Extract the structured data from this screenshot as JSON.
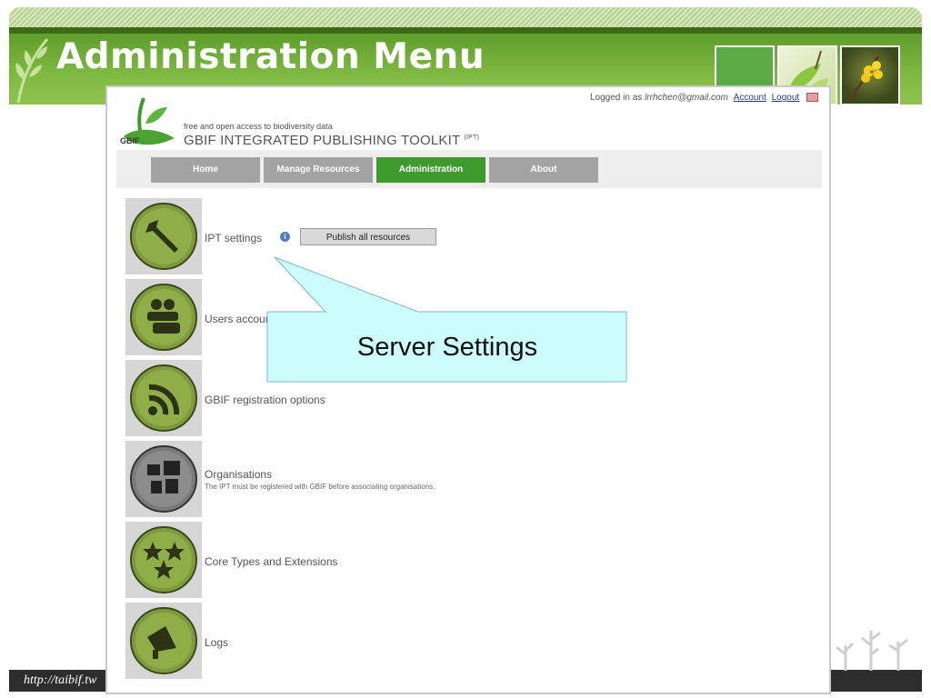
{
  "slide": {
    "title": "Administration Menu",
    "footer_url": "http://taibif.tw",
    "colors": {
      "title_band": "#7db840",
      "title_text": "#ffffff",
      "footer_bar": "#2d2d2d"
    }
  },
  "header": {
    "logged_in_prefix": "Logged in as",
    "user_email": "lrrhchen@gmail.com",
    "account_link": "Account",
    "logout_link": "Logout",
    "logo_text": "GBIF",
    "tagline": "free and open access to biodiversity data",
    "app_title": "GBIF INTEGRATED PUBLISHING TOOLKIT",
    "app_title_sup": "(IPT)"
  },
  "nav": {
    "tabs": [
      {
        "label": "Home",
        "active": false
      },
      {
        "label": "Manage Resources",
        "active": false
      },
      {
        "label": "Administration",
        "active": true
      },
      {
        "label": "About",
        "active": false
      }
    ],
    "colors": {
      "active": "#3f9a2e",
      "inactive": "#a3a3a3"
    }
  },
  "menu": {
    "items": [
      {
        "label": "IPT settings",
        "icon": "wrench-icon",
        "button": "Publish all resources"
      },
      {
        "label": "Users accounts",
        "icon": "users-icon"
      },
      {
        "label": "GBIF registration options",
        "icon": "rss-icon"
      },
      {
        "label": "Organisations",
        "icon": "organisations-icon",
        "note": "The IPT must be registered with GBIF before associating organisations."
      },
      {
        "label": "Core Types and Extensions",
        "icon": "stars-icon"
      },
      {
        "label": "Logs",
        "icon": "megaphone-icon"
      }
    ]
  },
  "callout": {
    "text": "Server Settings",
    "color": "#ccfcfc"
  }
}
